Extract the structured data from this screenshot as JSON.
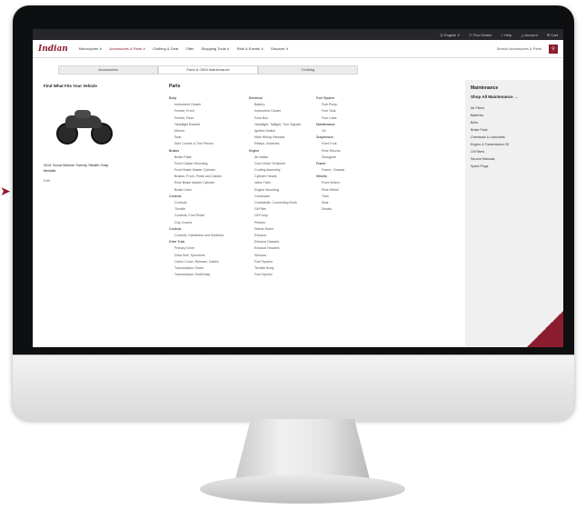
{
  "utility_bar": {
    "items": [
      "◎ English ∨",
      "☉ Find Dealer",
      "□ Help",
      "△ Account",
      "☰ Cart"
    ]
  },
  "nav": {
    "logo": "Indian",
    "items": [
      "Motorcycles ∨",
      "Accessories & Parts ∨",
      "Clothing & Gear",
      "Offer",
      "Shopping Tools ∨",
      "Ride & Events ∨",
      "Discover ∨"
    ],
    "search_text": "Search Accessories & Parts"
  },
  "tabs": [
    "Accessories",
    "Parts & OEM Maintenance",
    "Clothing"
  ],
  "vehicle": {
    "title": "Find What Fits Your Vehicle",
    "name": "2021 Scout Bobber Twenty Stealth Gray Metallic",
    "edit_label": "Edit"
  },
  "parts": {
    "title": "Parts",
    "col1": [
      {
        "t": "Body",
        "c": "head"
      },
      {
        "t": "Instrument Cluster",
        "c": "sub"
      },
      {
        "t": "Fender, Front",
        "c": "sub"
      },
      {
        "t": "Fender, Rear",
        "c": "sub"
      },
      {
        "t": "Headlight Bracket",
        "c": "sub"
      },
      {
        "t": "Mirrors",
        "c": "sub"
      },
      {
        "t": "Seat",
        "c": "sub"
      },
      {
        "t": "Side Covers & Trim Pieces",
        "c": "sub"
      },
      {
        "t": "Brakes",
        "c": "head"
      },
      {
        "t": "Brake Plate",
        "c": "sub"
      },
      {
        "t": "Front Caliper Mounting",
        "c": "sub"
      },
      {
        "t": "Front Brake Master Cylinder",
        "c": "sub"
      },
      {
        "t": "Brakes, Front, Pedal and Cables",
        "c": "sub"
      },
      {
        "t": "Rear Brake Master Cylinder",
        "c": "sub"
      },
      {
        "t": "Brake Lines",
        "c": "sub"
      },
      {
        "t": "Controls",
        "c": "head"
      },
      {
        "t": "Controls",
        "c": "sub"
      },
      {
        "t": "Throttle",
        "c": "sub"
      },
      {
        "t": "Controls, Foot Pedal",
        "c": "sub"
      },
      {
        "t": "Grip Covers",
        "c": "sub"
      },
      {
        "t": "Controls",
        "c": "head"
      },
      {
        "t": "Controls, Handlebar and Switches",
        "c": "sub"
      },
      {
        "t": "Drive Train",
        "c": "head"
      },
      {
        "t": "Primary Drive",
        "c": "sub"
      },
      {
        "t": "Drive Belt, Sprockets",
        "c": "sub"
      },
      {
        "t": "Clutch Cover, Release, Cables",
        "c": "sub"
      },
      {
        "t": "Transmission Gears",
        "c": "sub"
      },
      {
        "t": "Transmission Shaft Assy",
        "c": "sub"
      }
    ],
    "col2": [
      {
        "t": "Electrical",
        "c": "head"
      },
      {
        "t": "Battery",
        "c": "sub"
      },
      {
        "t": "Instrument Cluster",
        "c": "sub"
      },
      {
        "t": "Fuse Box",
        "c": "sub"
      },
      {
        "t": "Headlight, Taillight, Turn Signals",
        "c": "sub"
      },
      {
        "t": "Ignition Switch",
        "c": "sub"
      },
      {
        "t": "Main Wiring Harness",
        "c": "sub"
      },
      {
        "t": "Relays, Switches",
        "c": "sub"
      },
      {
        "t": "Engine",
        "c": "head"
      },
      {
        "t": "Air Intake",
        "c": "sub"
      },
      {
        "t": "Cam Chain Tensioner",
        "c": "sub"
      },
      {
        "t": "Cooling Assembly",
        "c": "sub"
      },
      {
        "t": "Cylinder Heads",
        "c": "sub"
      },
      {
        "t": "Valve Train",
        "c": "sub"
      },
      {
        "t": "Engine Mounting",
        "c": "sub"
      },
      {
        "t": "Crankcase",
        "c": "sub"
      },
      {
        "t": "Crankshaft, Connecting Rods",
        "c": "sub"
      },
      {
        "t": "Oil Filter",
        "c": "sub"
      },
      {
        "t": "Oil Pump",
        "c": "sub"
      },
      {
        "t": "Pistons",
        "c": "sub"
      },
      {
        "t": "Starter Motor",
        "c": "sub"
      },
      {
        "t": "Exhaust",
        "c": "sub"
      },
      {
        "t": "Exhaust Gaskets",
        "c": "sub"
      },
      {
        "t": "Exhaust Headers",
        "c": "sub"
      },
      {
        "t": "Sensors",
        "c": "sub"
      },
      {
        "t": "Fuel System",
        "c": "sub"
      },
      {
        "t": "Throttle Body",
        "c": "sub"
      },
      {
        "t": "Fuel Injector",
        "c": "sub"
      }
    ],
    "col3": [
      {
        "t": "Fuel System",
        "c": "head"
      },
      {
        "t": "Fuel Pump",
        "c": "sub"
      },
      {
        "t": "Fuel Tank",
        "c": "sub"
      },
      {
        "t": "Fuel Lines",
        "c": "sub"
      },
      {
        "t": "Maintenance",
        "c": "head"
      },
      {
        "t": "Oil",
        "c": "sub"
      },
      {
        "t": "Suspension",
        "c": "head"
      },
      {
        "t": "Front Fork",
        "c": "sub"
      },
      {
        "t": "Rear Shocks",
        "c": "sub"
      },
      {
        "t": "Swingarm",
        "c": "sub"
      },
      {
        "t": "Frame",
        "c": "head"
      },
      {
        "t": "Frame, Chassis",
        "c": "sub"
      },
      {
        "t": "Wheels",
        "c": "head"
      },
      {
        "t": "Front Wheel",
        "c": "sub"
      },
      {
        "t": "Rear Wheel",
        "c": "sub"
      },
      {
        "t": "Tires",
        "c": "sub"
      },
      {
        "t": "Seat",
        "c": "sub"
      },
      {
        "t": "Decals",
        "c": "sub"
      }
    ]
  },
  "maintenance": {
    "title": "Maintenance",
    "shop_all": "Shop All Maintenance →",
    "items": [
      "Air Filters",
      "Batteries",
      "Belts",
      "Brake Pads",
      "Chemicals & Lubricants",
      "Engine & Transmission Oil",
      "Oil Filters",
      "Service Manuals",
      "Spark Plugs"
    ]
  },
  "colors": {
    "accent": "#8c1d2e",
    "utility_bar": "#26272a"
  }
}
